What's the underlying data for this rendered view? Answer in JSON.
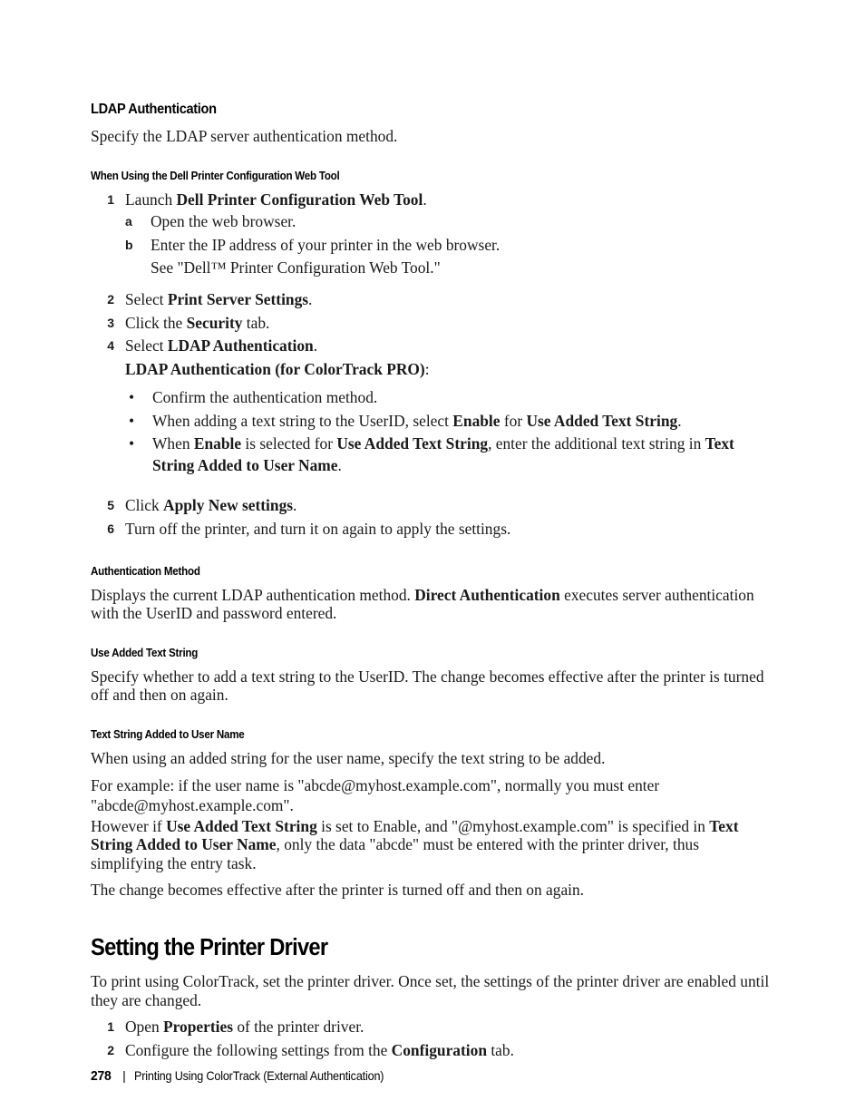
{
  "section": {
    "heading": "LDAP Authentication",
    "intro": "Specify the LDAP server authentication method."
  },
  "webtool": {
    "subheading": "When Using the Dell Printer Configuration Web Tool",
    "steps": [
      {
        "num": "1",
        "pre": "Launch ",
        "bold": "Dell Printer Configuration Web Tool",
        "post": "."
      },
      {
        "num": "2",
        "pre": "Select ",
        "bold": "Print Server Settings",
        "post": "."
      },
      {
        "num": "3",
        "pre": "Click the ",
        "bold": "Security",
        "post": " tab."
      },
      {
        "num": "4",
        "pre": "Select ",
        "bold": "LDAP Authentication",
        "post": "."
      },
      {
        "num": "5",
        "pre": "Click ",
        "bold": "Apply New settings",
        "post": "."
      },
      {
        "num": "6",
        "pre": "Turn off the printer, and turn it on again to apply the settings.",
        "bold": "",
        "post": ""
      }
    ],
    "substeps": [
      {
        "letter": "a",
        "text": "Open the web browser."
      },
      {
        "letter": "b",
        "text": "Enter the IP address of your printer in the web browser."
      }
    ],
    "see_reference": "See \"Dell™ Printer Configuration Web Tool.\"",
    "colortrack_label": "LDAP Authentication (for ColorTrack PRO)",
    "colortrack_colon": ":",
    "bullets": [
      {
        "segments": [
          {
            "text": "Confirm the authentication method.",
            "bold": false
          }
        ]
      },
      {
        "segments": [
          {
            "text": "When adding a text string to the UserID, select ",
            "bold": false
          },
          {
            "text": "Enable",
            "bold": true
          },
          {
            "text": " for ",
            "bold": false
          },
          {
            "text": "Use Added Text String",
            "bold": true
          },
          {
            "text": ".",
            "bold": false
          }
        ]
      },
      {
        "segments": [
          {
            "text": "When ",
            "bold": false
          },
          {
            "text": "Enable",
            "bold": true
          },
          {
            "text": " is selected for ",
            "bold": false
          },
          {
            "text": "Use Added Text String",
            "bold": true
          },
          {
            "text": ", enter the additional text string in ",
            "bold": false
          },
          {
            "text": "Text String Added to User Name",
            "bold": true
          },
          {
            "text": ".",
            "bold": false
          }
        ]
      }
    ]
  },
  "auth_method": {
    "subheading": "Authentication Method",
    "body": [
      {
        "text": "Displays the current LDAP authentication method. ",
        "bold": false
      },
      {
        "text": "Direct Authentication",
        "bold": true
      },
      {
        "text": " executes server authentication with the UserID and password entered.",
        "bold": false
      }
    ]
  },
  "use_added_text_string": {
    "subheading": "Use Added Text String",
    "body": [
      {
        "text": "Specify whether to add a text string to the UserID. The change becomes effective after the printer is turned off and then on again.",
        "bold": false
      }
    ]
  },
  "text_string_added": {
    "subheading": "Text String Added to User Name",
    "para1": "When using an added string for the user name, specify the text string to be added.",
    "para2_line1": "For example: if the user name is \"abcde@myhost.example.com\", normally you must enter",
    "para2_line2": "\"abcde@myhost.example.com\".",
    "para3": [
      {
        "text": "However if ",
        "bold": false
      },
      {
        "text": "Use Added Text String",
        "bold": true
      },
      {
        "text": " is set to Enable, and \"@myhost.example.com\" is specified in ",
        "bold": false
      },
      {
        "text": "Text String Added to User Name",
        "bold": true
      },
      {
        "text": ", only the data \"abcde\" must be entered with the printer driver, thus simplifying the entry task.",
        "bold": false
      }
    ],
    "para4": "The change becomes effective after the printer is turned off and then on again."
  },
  "printer_driver": {
    "heading": "Setting the Printer Driver",
    "intro": "To print using ColorTrack, set the printer driver. Once set, the settings of the printer driver are enabled until they are changed.",
    "steps": [
      {
        "num": "1",
        "pre": "Open ",
        "bold": "Properties",
        "post": " of the printer driver."
      },
      {
        "num": "2",
        "pre": "Configure the following settings from the ",
        "bold": "Configuration",
        "post": " tab."
      }
    ]
  },
  "footer": {
    "page_number": "278",
    "separator": "|",
    "chapter": "Printing Using ColorTrack (External Authentication)"
  },
  "bullet_glyph": "•"
}
